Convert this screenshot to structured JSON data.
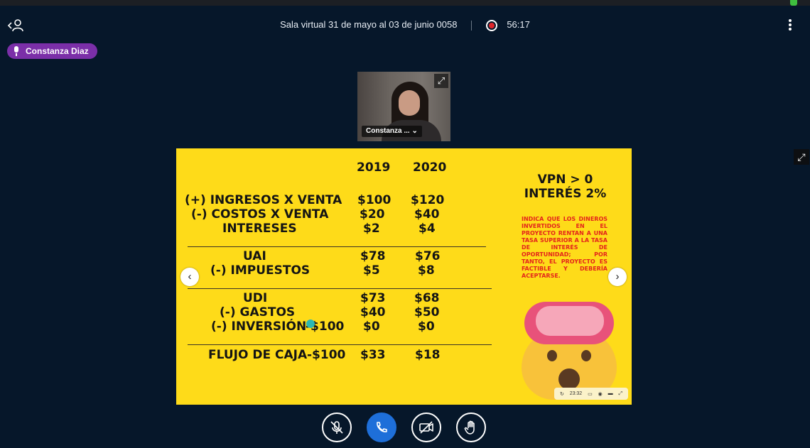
{
  "session": {
    "title": "Sala virtual 31 de mayo al 03 de junio 0058",
    "timer": "56:17"
  },
  "icons": {
    "user": "user-icon",
    "recording": "recording-icon",
    "more": "more-vertical-icon",
    "mic": "microphone-icon",
    "expand": "expand-icon"
  },
  "speaker": {
    "name": "Constanza Diaz"
  },
  "video": {
    "name": "Constanza ...",
    "chevron": "⌄"
  },
  "slide": {
    "years": [
      "2019",
      "2020"
    ],
    "rows": {
      "ingresos": {
        "label": "(+) INGRESOS X VENTA",
        "v2019": "$100",
        "v2020": "$120"
      },
      "costos": {
        "label": "(-) COSTOS X VENTA",
        "v2019": "$20",
        "v2020": "$40"
      },
      "intereses": {
        "label": "INTERESES",
        "v2019": "$2",
        "v2020": "$4"
      },
      "uai": {
        "label": "UAI",
        "v2019": "$78",
        "v2020": "$76"
      },
      "impuestos": {
        "label": "(-) IMPUESTOS",
        "v2019": "$5",
        "v2020": "$8"
      },
      "udi": {
        "label": "UDI",
        "v2019": "$73",
        "v2020": "$68"
      },
      "gastos": {
        "label": "(-) GASTOS",
        "v2019": "$40",
        "v2020": "$50"
      },
      "inversion": {
        "label": "(-) INVERSIÓN",
        "v2018": "-$100",
        "v2019": "$0",
        "v2020": "$0"
      },
      "flujo": {
        "label": "FLUJO DE CAJA",
        "v2018": "-$100",
        "v2019": "$33",
        "v2020": "$18"
      }
    },
    "vpn_line1": "VPN > 0",
    "vpn_line2": "INTERÉS 2%",
    "note": "INDICA QUE LOS DINEROS INVERTIDOS EN EL PROYECTO RENTAN A UNA TASA SUPERIOR A LA TASA DE INTERÉS DE OPORTUNIDAD; POR TANTO, EL PROYECTO ES FACTIBLE Y DEBERÍA ACEPTARSE.",
    "player_time": "23:32"
  },
  "colors": {
    "background": "#06172a",
    "slide": "#fedb19",
    "speaker_pill": "#7b2fa8",
    "call_button": "#1e6fd9",
    "note_text": "#e4241b",
    "recording": "#e0262b"
  }
}
